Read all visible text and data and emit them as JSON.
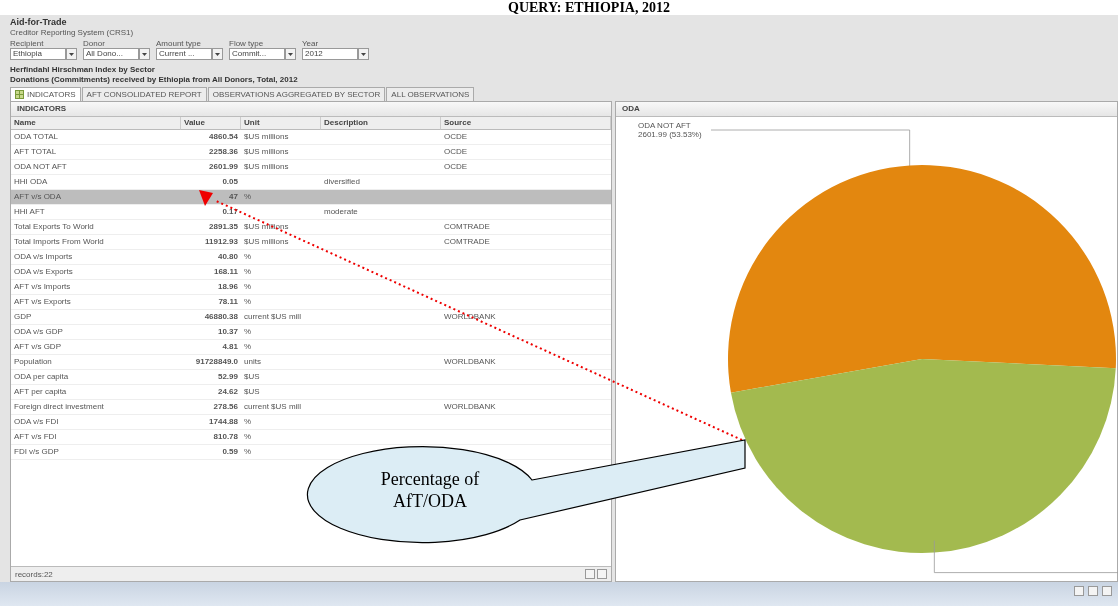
{
  "document_title": "QUERY: ETHIOPIA, 2012",
  "app": {
    "title": "Aid-for-Trade",
    "subtitle": "Creditor Reporting System (CRS1)"
  },
  "filters": [
    {
      "label": "Recipient",
      "value": "Ethiopia"
    },
    {
      "label": "Donor",
      "value": "All Dono..."
    },
    {
      "label": "Amount type",
      "value": "Current ..."
    },
    {
      "label": "Flow type",
      "value": "Commit..."
    },
    {
      "label": "Year",
      "value": "2012"
    }
  ],
  "report_heading": [
    "Herfindahl Hirschman Index by Sector",
    "Donations (Commitments) received by Ethiopia from All Donors, Total, 2012"
  ],
  "tabs": [
    {
      "label": "INDICATORS",
      "selected": true
    },
    {
      "label": "AFT CONSOLIDATED REPORT",
      "selected": false
    },
    {
      "label": "OBSERVATIONS AGGREGATED BY SECTOR",
      "selected": false
    },
    {
      "label": "ALL OBSERVATIONS",
      "selected": false
    }
  ],
  "indicators": {
    "title": "INDICATORS",
    "columns": [
      "Name",
      "Value",
      "Unit",
      "Description",
      "Source"
    ],
    "rows": [
      {
        "cells": [
          "ODA TOTAL",
          "4860.54",
          "$US millions",
          "",
          "OCDE"
        ],
        "selected": false
      },
      {
        "cells": [
          "AFT TOTAL",
          "2258.36",
          "$US millions",
          "",
          "OCDE"
        ],
        "selected": false
      },
      {
        "cells": [
          "ODA NOT AFT",
          "2601.99",
          "$US millions",
          "",
          "OCDE"
        ],
        "selected": false
      },
      {
        "cells": [
          "HHI ODA",
          "0.05",
          "",
          "diversified",
          ""
        ],
        "selected": false
      },
      {
        "cells": [
          "AFT v/s ODA",
          "47",
          "%",
          "",
          ""
        ],
        "selected": true
      },
      {
        "cells": [
          "HHI AFT",
          "0.17",
          "",
          "moderate",
          ""
        ],
        "selected": false
      },
      {
        "cells": [
          "Total Exports To World",
          "2891.35",
          "$US millions",
          "",
          "COMTRADE"
        ],
        "selected": false
      },
      {
        "cells": [
          "Total Imports From World",
          "11912.93",
          "$US millions",
          "",
          "COMTRADE"
        ],
        "selected": false
      },
      {
        "cells": [
          "ODA v/s Imports",
          "40.80",
          "%",
          "",
          ""
        ],
        "selected": false
      },
      {
        "cells": [
          "ODA v/s Exports",
          "168.11",
          "%",
          "",
          ""
        ],
        "selected": false
      },
      {
        "cells": [
          "AFT v/s Imports",
          "18.96",
          "%",
          "",
          ""
        ],
        "selected": false
      },
      {
        "cells": [
          "AFT v/s Exports",
          "78.11",
          "%",
          "",
          ""
        ],
        "selected": false
      },
      {
        "cells": [
          "GDP",
          "46880.38",
          "current $US mill",
          "",
          "WORLDBANK"
        ],
        "selected": false
      },
      {
        "cells": [
          "ODA v/s GDP",
          "10.37",
          "%",
          "",
          ""
        ],
        "selected": false
      },
      {
        "cells": [
          "AFT v/s GDP",
          "4.81",
          "%",
          "",
          ""
        ],
        "selected": false
      },
      {
        "cells": [
          "Population",
          "91728849.0",
          "units",
          "",
          "WORLDBANK"
        ],
        "selected": false
      },
      {
        "cells": [
          "ODA per capita",
          "52.99",
          "$US",
          "",
          ""
        ],
        "selected": false
      },
      {
        "cells": [
          "AFT per capita",
          "24.62",
          "$US",
          "",
          ""
        ],
        "selected": false
      },
      {
        "cells": [
          "Foreign direct investment",
          "278.56",
          "current $US mill",
          "",
          "WORLDBANK"
        ],
        "selected": false
      },
      {
        "cells": [
          "ODA v/s FDI",
          "1744.88",
          "%",
          "",
          ""
        ],
        "selected": false
      },
      {
        "cells": [
          "AFT v/s FDI",
          "810.78",
          "%",
          "",
          ""
        ],
        "selected": false
      },
      {
        "cells": [
          "FDI v/s GDP",
          "0.59",
          "%",
          "",
          ""
        ],
        "selected": false
      }
    ],
    "footer": "records:22"
  },
  "oda_panel": {
    "title": "ODA",
    "slice_label": [
      "ODA NOT AFT",
      "2601.99 (53.53%)"
    ],
    "chart_data": {
      "type": "pie",
      "series": [
        {
          "values": [
            53.53,
            46.47
          ]
        }
      ],
      "colors": [
        "#e3870f",
        "#a3ba4f"
      ]
    }
  },
  "callout": {
    "text": "Percentage of AfT/ODA"
  }
}
